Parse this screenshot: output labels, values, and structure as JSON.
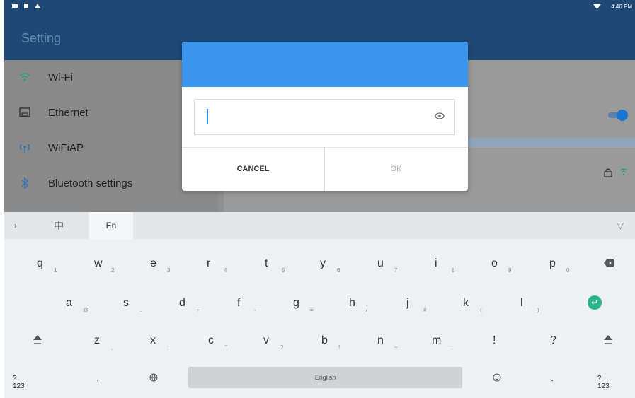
{
  "status_bar": {
    "time": "4:46 PM"
  },
  "app_bar": {
    "title": "Setting"
  },
  "sidebar": {
    "items": [
      {
        "label": "Wi-Fi",
        "icon": "wifi-icon"
      },
      {
        "label": "Ethernet",
        "icon": "ethernet-icon"
      },
      {
        "label": "WiFiAP",
        "icon": "hotspot-icon"
      },
      {
        "label": "Bluetooth settings",
        "icon": "bluetooth-icon"
      }
    ]
  },
  "dialog": {
    "password_value": "",
    "cancel_label": "CANCEL",
    "ok_label": "OK"
  },
  "keyboard": {
    "tabs": {
      "chinese": "中",
      "english": "En"
    },
    "space_label": "English",
    "rows": {
      "row1": [
        {
          "key": "q",
          "sub": "1"
        },
        {
          "key": "w",
          "sub": "2"
        },
        {
          "key": "e",
          "sub": "3"
        },
        {
          "key": "r",
          "sub": "4"
        },
        {
          "key": "t",
          "sub": "5"
        },
        {
          "key": "y",
          "sub": "6"
        },
        {
          "key": "u",
          "sub": "7"
        },
        {
          "key": "i",
          "sub": "8"
        },
        {
          "key": "o",
          "sub": "9"
        },
        {
          "key": "p",
          "sub": "0"
        }
      ],
      "row2": [
        {
          "key": "a",
          "sub": "@"
        },
        {
          "key": "s",
          "sub": "."
        },
        {
          "key": "d",
          "sub": "+"
        },
        {
          "key": "f",
          "sub": "-"
        },
        {
          "key": "g",
          "sub": "="
        },
        {
          "key": "h",
          "sub": "/"
        },
        {
          "key": "j",
          "sub": "#"
        },
        {
          "key": "k",
          "sub": "("
        },
        {
          "key": "l",
          "sub": ")"
        }
      ],
      "row3": [
        {
          "key": "z",
          "sub": ","
        },
        {
          "key": "x",
          "sub": ":"
        },
        {
          "key": "c",
          "sub": "\""
        },
        {
          "key": "v",
          "sub": "?"
        },
        {
          "key": "b",
          "sub": "!"
        },
        {
          "key": "n",
          "sub": "~"
        },
        {
          "key": "m",
          "sub": "..."
        },
        {
          "key": "!",
          "sub": ""
        },
        {
          "key": "?",
          "sub": ""
        }
      ],
      "bottom": {
        "num_left": "?123",
        "comma": ",",
        "period": ".",
        "num_right": "?123"
      }
    }
  },
  "colors": {
    "appbar": "#1f4875",
    "dialog_header": "#3b95ee",
    "enter_key": "#2bb38b"
  }
}
